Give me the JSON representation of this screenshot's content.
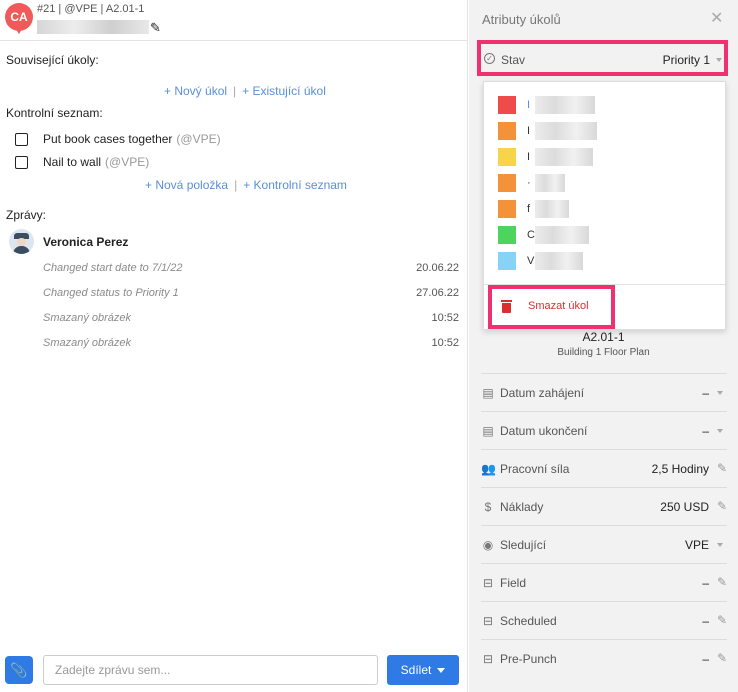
{
  "header": {
    "badge": "CA",
    "meta": "#21 | @VPE | A2.01-1",
    "edit_icon": "pencil-icon"
  },
  "related": {
    "label": "Související úkoly:",
    "new_link": "+ Nový úkol",
    "existing_link": "+ Existující úkol"
  },
  "checklist": {
    "label": "Kontrolní seznam:",
    "items": [
      {
        "text": "Put book cases together",
        "tag": "(@VPE)"
      },
      {
        "text": "Nail to wall",
        "tag": "(@VPE)"
      }
    ],
    "new_item_link": "+ Nová položka",
    "new_list_link": "+ Kontrolní seznam"
  },
  "messages": {
    "label": "Zprávy:",
    "author": "Veronica Perez",
    "items": [
      {
        "text": "Changed start date to 7/1/22",
        "time": "20.06.22"
      },
      {
        "text": "Changed status to Priority 1",
        "time": "27.06.22"
      },
      {
        "text": "Smazaný obrázek",
        "time": "10:52"
      },
      {
        "text": "Smazaný obrázek",
        "time": "10:52"
      }
    ]
  },
  "composer": {
    "placeholder": "Zadejte zprávu sem...",
    "share_label": "Sdílet",
    "attach_icon": "paperclip-icon"
  },
  "panel": {
    "title": "Atributy úkolů",
    "status_label": "Stav",
    "status_value": "Priority 1",
    "task_name": "A2.01-1",
    "task_plan": "Building 1 Floor Plan",
    "attributes": [
      {
        "icon": "calendar-icon",
        "label": "Datum zahájení",
        "value": "–",
        "action": "caret"
      },
      {
        "icon": "calendar-icon",
        "label": "Datum ukončení",
        "value": "–",
        "action": "caret"
      },
      {
        "icon": "people-icon",
        "label": "Pracovní síla",
        "value": "2,5  Hodiny",
        "action": "pencil"
      },
      {
        "icon": "dollar-icon",
        "label": "Náklady",
        "value": "250  USD",
        "action": "pencil"
      },
      {
        "icon": "eye-icon",
        "label": "Sledující",
        "value": "VPE",
        "action": "caret"
      },
      {
        "icon": "field-icon",
        "label": "Field",
        "value": "–",
        "action": "pencil"
      },
      {
        "icon": "field-icon",
        "label": "Scheduled",
        "value": "–",
        "action": "pencil"
      },
      {
        "icon": "field-icon",
        "label": "Pre-Punch",
        "value": "–",
        "action": "pencil"
      }
    ]
  },
  "dropdown": {
    "options": [
      {
        "color": "#f04b4b",
        "initial": "I",
        "initial_color": "#5a8fd8"
      },
      {
        "color": "#f39239",
        "initial": "I"
      },
      {
        "color": "#f6d54a",
        "initial": "I"
      },
      {
        "color": "#f39239",
        "initial": "·"
      },
      {
        "color": "#f39239",
        "initial": "f"
      },
      {
        "color": "#4cd45c",
        "initial": "C"
      },
      {
        "color": "#86d3f5",
        "initial": "V"
      }
    ],
    "delete_label": "Smazat úkol"
  },
  "colors": {
    "accent": "#2f7ae5",
    "highlight": "#f0316f",
    "danger": "#d9302f",
    "link": "#5a8fd8"
  }
}
